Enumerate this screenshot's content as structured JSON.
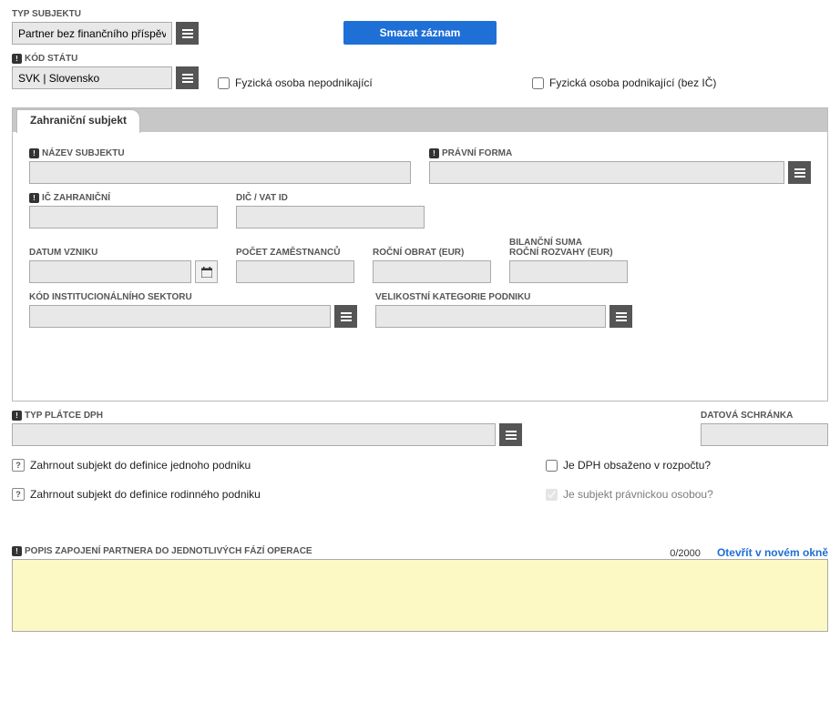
{
  "top": {
    "typ_subjektu_label": "TYP SUBJEKTU",
    "typ_subjektu_value": "Partner bez finančního příspěvku",
    "smazat_button": "Smazat záznam",
    "kod_statu_label": "KÓD STÁTU",
    "kod_statu_value": "SVK | Slovensko",
    "fyz_nepodnik": "Fyzická osoba nepodnikající",
    "fyz_podnik": "Fyzická osoba podnikající (bez IČ)"
  },
  "tab": {
    "label": "Zahraniční subjekt"
  },
  "form": {
    "nazev_subjektu": "NÁZEV SUBJEKTU",
    "pravni_forma": "PRÁVNÍ FORMA",
    "ic_zahranicni": "IČ ZAHRANIČNÍ",
    "dic_vat": "DIČ / VAT ID",
    "datum_vzniku": "DATUM VZNIKU",
    "pocet_zam": "POČET ZAMĚSTNANCŮ",
    "rocni_obrat": "ROČNÍ OBRAT (EUR)",
    "bilancni_suma": "BILANČNÍ SUMA",
    "rocni_rozvahy": "ROČNÍ ROZVAHY (EUR)",
    "kod_inst": "KÓD INSTITUCIONÁLNÍHO SEKTORU",
    "velikost_kat": "VELIKOSTNÍ KATEGORIE PODNIKU"
  },
  "lower": {
    "typ_platce": "TYP PLÁTCE DPH",
    "datova_schranka": "DATOVÁ SCHRÁNKA",
    "zahrnout_jednoho": "Zahrnout subjekt do definice jednoho podniku",
    "zahrnout_rodin": "Zahrnout subjekt do definice rodinného podniku",
    "je_dph": "Je DPH obsaženo v rozpočtu?",
    "je_subjekt": "Je subjekt právnickou osobou?"
  },
  "desc": {
    "label": "POPIS ZAPOJENÍ PARTNERA DO JEDNOTLIVÝCH FÁZÍ OPERACE",
    "count": "0/2000",
    "open_new": "Otevřít v novém okně"
  }
}
